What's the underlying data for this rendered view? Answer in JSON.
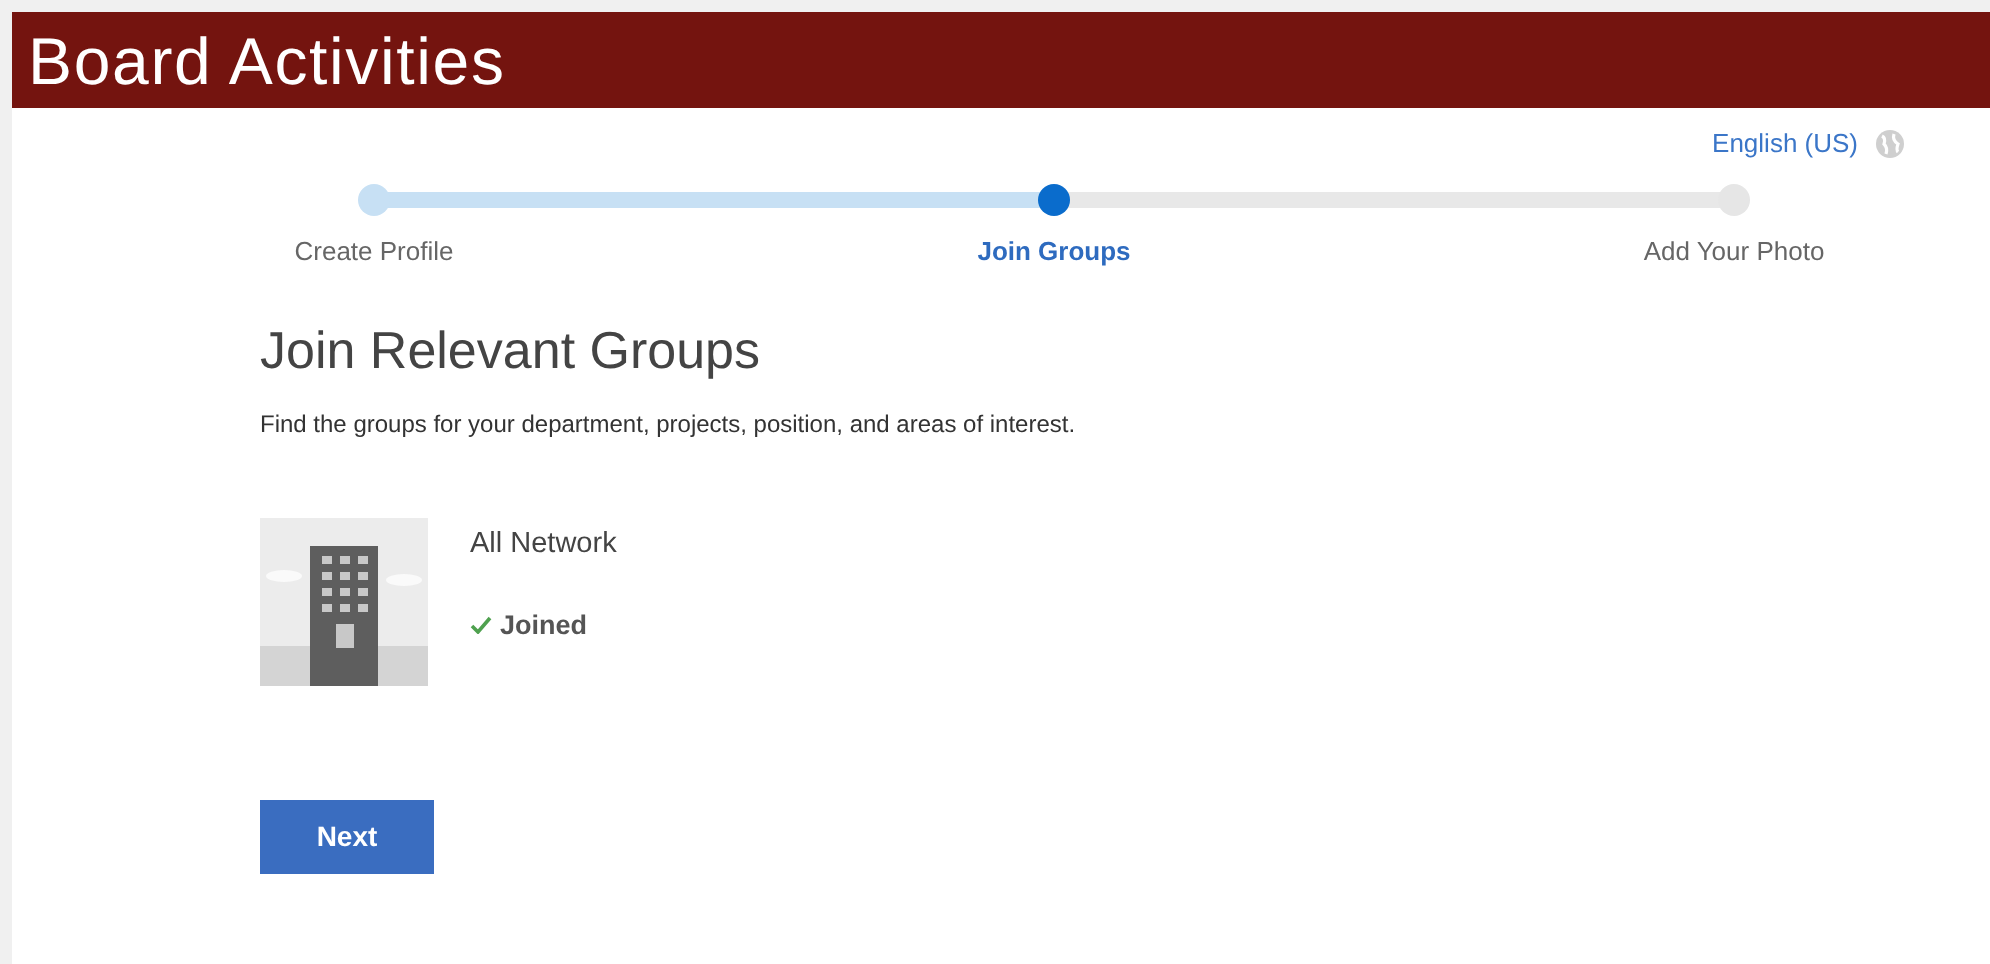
{
  "header": {
    "title": "Board Activities"
  },
  "language": {
    "label": "English (US)"
  },
  "steps": [
    {
      "label": "Create Profile",
      "done": true,
      "selected": false
    },
    {
      "label": "Join Groups",
      "done": false,
      "selected": true
    },
    {
      "label": "Add Your Photo",
      "done": false,
      "selected": false
    }
  ],
  "heading": "Join Relevant Groups",
  "description": "Find the groups for your department, projects, position, and areas of interest.",
  "groups": [
    {
      "name": "All Network",
      "joined": true,
      "status": "Joined"
    }
  ],
  "buttons": [
    {
      "label": "Next"
    }
  ]
}
